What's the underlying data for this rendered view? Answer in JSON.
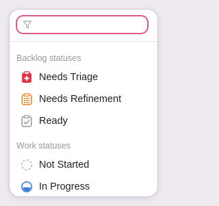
{
  "search": {
    "placeholder": "",
    "value": "",
    "icon": "filter-icon"
  },
  "sections": [
    {
      "header": "Backlog statuses",
      "items": [
        {
          "label": "Needs Triage",
          "icon": "clipboard-plus-icon",
          "color": "#e0364a"
        },
        {
          "label": "Needs Refinement",
          "icon": "clipboard-list-icon",
          "color": "#ee8a2a"
        },
        {
          "label": "Ready",
          "icon": "clipboard-check-icon",
          "color": "#9d9aa0"
        }
      ]
    },
    {
      "header": "Work statuses",
      "items": [
        {
          "label": "Not Started",
          "icon": "dashed-circle-icon",
          "color": "#b9b5bb"
        },
        {
          "label": "In Progress",
          "icon": "half-circle-icon",
          "color": "#3f7fd8"
        }
      ]
    }
  ],
  "colors": {
    "accent": "#e0568e"
  }
}
